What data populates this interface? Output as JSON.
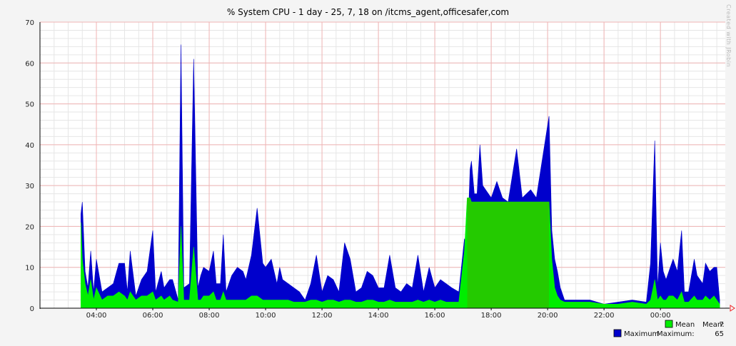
{
  "chart_data": {
    "type": "area",
    "title": "% System CPU - 1 day - 25, 7, 18 on /itcms_agent,officesafer,com",
    "xlabel": "",
    "ylabel": "",
    "xlim": [
      2.0,
      26.3
    ],
    "ylim": [
      0,
      70
    ],
    "y_ticks": [
      "0",
      "10",
      "20",
      "30",
      "40",
      "50",
      "60",
      "70"
    ],
    "x_ticks": [
      {
        "label": "04:00",
        "hour": 4
      },
      {
        "label": "06:00",
        "hour": 6
      },
      {
        "label": "08:00",
        "hour": 8
      },
      {
        "label": "10:00",
        "hour": 10
      },
      {
        "label": "12:00",
        "hour": 12
      },
      {
        "label": "14:00",
        "hour": 14
      },
      {
        "label": "16:00",
        "hour": 16
      },
      {
        "label": "18:00",
        "hour": 18
      },
      {
        "label": "20:00",
        "hour": 20
      },
      {
        "label": "22:00",
        "hour": 22
      },
      {
        "label": "00:00",
        "hour": 24
      }
    ],
    "grid": true,
    "legend_position": "bottom-right",
    "series": [
      {
        "name": "Maximum",
        "color": "#0000cc",
        "stat_label": "Maximum:",
        "stat_value": "65",
        "values": [
          [
            3.45,
            23
          ],
          [
            3.5,
            26
          ],
          [
            3.6,
            9
          ],
          [
            3.7,
            5
          ],
          [
            3.8,
            14
          ],
          [
            3.9,
            4
          ],
          [
            4.0,
            12
          ],
          [
            4.2,
            4
          ],
          [
            4.4,
            5
          ],
          [
            4.6,
            6
          ],
          [
            4.8,
            11
          ],
          [
            5.0,
            11
          ],
          [
            5.1,
            4
          ],
          [
            5.2,
            14
          ],
          [
            5.4,
            3
          ],
          [
            5.6,
            7
          ],
          [
            5.8,
            9
          ],
          [
            6.0,
            19
          ],
          [
            6.1,
            4
          ],
          [
            6.3,
            9
          ],
          [
            6.4,
            5
          ],
          [
            6.6,
            7
          ],
          [
            6.7,
            7
          ],
          [
            6.9,
            2
          ],
          [
            7.0,
            64.5
          ],
          [
            7.1,
            5
          ],
          [
            7.3,
            6
          ],
          [
            7.45,
            61
          ],
          [
            7.6,
            5
          ],
          [
            7.7,
            8
          ],
          [
            7.8,
            10
          ],
          [
            8.0,
            9
          ],
          [
            8.15,
            14
          ],
          [
            8.25,
            6
          ],
          [
            8.4,
            6
          ],
          [
            8.5,
            18
          ],
          [
            8.6,
            4
          ],
          [
            8.8,
            8
          ],
          [
            9.0,
            10
          ],
          [
            9.2,
            9
          ],
          [
            9.3,
            7
          ],
          [
            9.5,
            13
          ],
          [
            9.7,
            24.5
          ],
          [
            9.9,
            11
          ],
          [
            10.0,
            10
          ],
          [
            10.2,
            12
          ],
          [
            10.4,
            6
          ],
          [
            10.5,
            10
          ],
          [
            10.6,
            7
          ],
          [
            10.8,
            6
          ],
          [
            11.0,
            5
          ],
          [
            11.2,
            4
          ],
          [
            11.4,
            2
          ],
          [
            11.6,
            6
          ],
          [
            11.8,
            13
          ],
          [
            12.0,
            4
          ],
          [
            12.2,
            8
          ],
          [
            12.4,
            7
          ],
          [
            12.6,
            4
          ],
          [
            12.8,
            16
          ],
          [
            13.0,
            12
          ],
          [
            13.2,
            4
          ],
          [
            13.4,
            5
          ],
          [
            13.6,
            9
          ],
          [
            13.8,
            8
          ],
          [
            14.0,
            5
          ],
          [
            14.2,
            5
          ],
          [
            14.4,
            13
          ],
          [
            14.6,
            5
          ],
          [
            14.8,
            4
          ],
          [
            15.0,
            6
          ],
          [
            15.2,
            5
          ],
          [
            15.4,
            13
          ],
          [
            15.6,
            4
          ],
          [
            15.8,
            10
          ],
          [
            16.0,
            5
          ],
          [
            16.2,
            7
          ],
          [
            16.4,
            6
          ],
          [
            16.6,
            5
          ],
          [
            16.85,
            4
          ],
          [
            17.05,
            17
          ],
          [
            17.15,
            14
          ],
          [
            17.25,
            34
          ],
          [
            17.3,
            36
          ],
          [
            17.4,
            28
          ],
          [
            17.5,
            28
          ],
          [
            17.6,
            40
          ],
          [
            17.7,
            30
          ],
          [
            17.9,
            28
          ],
          [
            18.0,
            27
          ],
          [
            18.2,
            31
          ],
          [
            18.4,
            27
          ],
          [
            18.6,
            26
          ],
          [
            18.9,
            39
          ],
          [
            19.1,
            27
          ],
          [
            19.4,
            29
          ],
          [
            19.6,
            27
          ],
          [
            20.05,
            47
          ],
          [
            20.15,
            19
          ],
          [
            20.25,
            12
          ],
          [
            20.35,
            9
          ],
          [
            20.45,
            5
          ],
          [
            20.6,
            2
          ],
          [
            21.0,
            2
          ],
          [
            21.5,
            2
          ],
          [
            22.0,
            1
          ],
          [
            22.5,
            1.5
          ],
          [
            23.0,
            2
          ],
          [
            23.5,
            1.5
          ],
          [
            23.65,
            11
          ],
          [
            23.8,
            41
          ],
          [
            23.9,
            5
          ],
          [
            24.0,
            16
          ],
          [
            24.1,
            9
          ],
          [
            24.2,
            7
          ],
          [
            24.3,
            9
          ],
          [
            24.45,
            12
          ],
          [
            24.6,
            9
          ],
          [
            24.75,
            19
          ],
          [
            24.85,
            4
          ],
          [
            25.0,
            4
          ],
          [
            25.2,
            12
          ],
          [
            25.3,
            8
          ],
          [
            25.5,
            6
          ],
          [
            25.6,
            11
          ],
          [
            25.75,
            9
          ],
          [
            25.9,
            10
          ],
          [
            26.0,
            10
          ],
          [
            26.1,
            2
          ]
        ]
      },
      {
        "name": "Mean",
        "color": "#00ee00",
        "stat_label": "Mean:",
        "stat_value": "7",
        "values": [
          [
            3.45,
            21
          ],
          [
            3.5,
            12
          ],
          [
            3.6,
            6
          ],
          [
            3.7,
            3
          ],
          [
            3.8,
            7
          ],
          [
            3.9,
            2
          ],
          [
            4.0,
            5
          ],
          [
            4.2,
            2
          ],
          [
            4.4,
            3
          ],
          [
            4.6,
            3
          ],
          [
            4.8,
            4
          ],
          [
            5.0,
            3
          ],
          [
            5.1,
            2
          ],
          [
            5.2,
            4
          ],
          [
            5.4,
            2
          ],
          [
            5.6,
            3
          ],
          [
            5.8,
            3
          ],
          [
            6.0,
            4
          ],
          [
            6.1,
            2
          ],
          [
            6.3,
            3
          ],
          [
            6.4,
            2
          ],
          [
            6.6,
            3
          ],
          [
            6.7,
            2
          ],
          [
            6.9,
            1.5
          ],
          [
            7.0,
            20
          ],
          [
            7.1,
            2
          ],
          [
            7.3,
            2
          ],
          [
            7.45,
            15
          ],
          [
            7.6,
            2
          ],
          [
            7.7,
            2
          ],
          [
            7.8,
            3
          ],
          [
            8.0,
            3
          ],
          [
            8.15,
            4
          ],
          [
            8.25,
            2
          ],
          [
            8.4,
            2
          ],
          [
            8.5,
            4
          ],
          [
            8.6,
            2
          ],
          [
            8.8,
            2
          ],
          [
            9.0,
            2
          ],
          [
            9.2,
            2
          ],
          [
            9.3,
            2
          ],
          [
            9.5,
            3
          ],
          [
            9.7,
            3
          ],
          [
            9.9,
            2
          ],
          [
            10.0,
            2
          ],
          [
            10.2,
            2
          ],
          [
            10.4,
            2
          ],
          [
            10.5,
            2
          ],
          [
            10.6,
            2
          ],
          [
            10.8,
            2
          ],
          [
            11.0,
            1.5
          ],
          [
            11.2,
            1.5
          ],
          [
            11.4,
            1.5
          ],
          [
            11.6,
            2
          ],
          [
            11.8,
            2
          ],
          [
            12.0,
            1.5
          ],
          [
            12.2,
            2
          ],
          [
            12.4,
            2
          ],
          [
            12.6,
            1.5
          ],
          [
            12.8,
            2
          ],
          [
            13.0,
            2
          ],
          [
            13.2,
            1.5
          ],
          [
            13.4,
            1.5
          ],
          [
            13.6,
            2
          ],
          [
            13.8,
            2
          ],
          [
            14.0,
            1.5
          ],
          [
            14.2,
            1.5
          ],
          [
            14.4,
            2
          ],
          [
            14.6,
            1.5
          ],
          [
            14.8,
            1.5
          ],
          [
            15.0,
            1.5
          ],
          [
            15.2,
            1.5
          ],
          [
            15.4,
            2
          ],
          [
            15.6,
            1.5
          ],
          [
            15.8,
            2
          ],
          [
            16.0,
            1.5
          ],
          [
            16.2,
            2
          ],
          [
            16.4,
            1.5
          ],
          [
            16.6,
            1.5
          ],
          [
            16.85,
            1.5
          ],
          [
            17.05,
            14
          ],
          [
            17.15,
            27
          ],
          [
            17.25,
            27
          ],
          [
            17.3,
            26
          ],
          [
            17.4,
            26
          ],
          [
            17.5,
            26
          ],
          [
            17.6,
            26
          ],
          [
            17.7,
            26
          ],
          [
            17.9,
            26
          ],
          [
            18.0,
            26
          ],
          [
            18.2,
            26
          ],
          [
            18.4,
            26
          ],
          [
            18.6,
            26
          ],
          [
            18.9,
            26
          ],
          [
            19.1,
            26
          ],
          [
            19.4,
            26
          ],
          [
            19.6,
            26
          ],
          [
            20.05,
            26
          ],
          [
            20.15,
            12
          ],
          [
            20.25,
            5
          ],
          [
            20.35,
            3
          ],
          [
            20.45,
            2
          ],
          [
            20.6,
            1.5
          ],
          [
            21.0,
            1.5
          ],
          [
            21.5,
            1.5
          ],
          [
            22.0,
            1
          ],
          [
            22.5,
            1
          ],
          [
            23.0,
            1.5
          ],
          [
            23.5,
            1
          ],
          [
            23.65,
            2
          ],
          [
            23.8,
            7
          ],
          [
            23.9,
            2
          ],
          [
            24.0,
            3
          ],
          [
            24.1,
            2
          ],
          [
            24.2,
            2
          ],
          [
            24.3,
            3
          ],
          [
            24.45,
            3
          ],
          [
            24.6,
            2
          ],
          [
            24.75,
            4
          ],
          [
            24.85,
            1.5
          ],
          [
            25.0,
            1.5
          ],
          [
            25.2,
            3
          ],
          [
            25.3,
            2
          ],
          [
            25.5,
            2
          ],
          [
            25.6,
            3
          ],
          [
            25.75,
            2
          ],
          [
            25.9,
            3
          ],
          [
            26.0,
            2
          ],
          [
            26.1,
            1
          ]
        ]
      }
    ]
  },
  "watermark": "Created with JRobin"
}
